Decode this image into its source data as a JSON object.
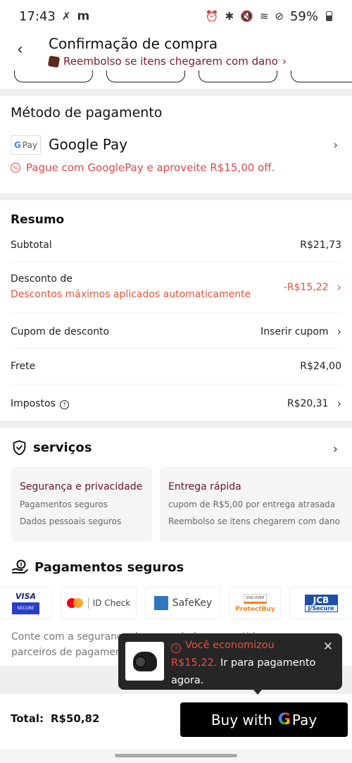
{
  "status_bar": {
    "time": "17:43",
    "left_icons": [
      "missed-call-icon",
      "m-app-icon"
    ],
    "right_icons": [
      "alarm-icon",
      "bluetooth-icon",
      "mute-icon",
      "wifi-icon",
      "do-not-disturb-icon"
    ],
    "battery": "59%"
  },
  "header": {
    "title": "Confirmação de compra",
    "refund_link": "Reembolso se itens chegarem com dano",
    "refund_chevron": "›"
  },
  "payment": {
    "heading": "Método de pagamento",
    "badge": "Pay",
    "method_name": "Google Pay",
    "promo": "Pague com GooglePay e aproveite R$15,00 off."
  },
  "summary": {
    "heading": "Resumo",
    "rows": [
      {
        "label": "Subtotal",
        "value": "R$21,73"
      },
      {
        "label": "Desconto de",
        "sublabel": "Descontos máximos aplicados automaticamente",
        "value": "-R$15,22"
      },
      {
        "label": "Cupom de desconto",
        "value": "Inserir cupom"
      },
      {
        "label": "Frete",
        "value": "R$24,00"
      },
      {
        "label": "Impostos",
        "value": "R$20,31"
      }
    ]
  },
  "services": {
    "heading": "serviços",
    "cards": [
      {
        "title": "Segurança e privacidade",
        "lines": [
          "Pagamentos seguros",
          "Dados pessoais seguros"
        ]
      },
      {
        "title": "Entrega rápida",
        "lines": [
          "cupom de R$5,00 por entrega atrasada",
          "Reembolso se itens chegarem com dano"
        ]
      }
    ]
  },
  "secure_payments": {
    "heading": "Pagamentos seguros",
    "logos": [
      {
        "top": "VISA",
        "bottom": "SECURE"
      },
      {
        "label": "ID Check"
      },
      {
        "label": "SafeKey"
      },
      {
        "top": "DISCOVER",
        "bottom": "ProtectBuy"
      },
      {
        "top": "JCB",
        "bottom": "J/Secure"
      }
    ],
    "note": "Conte com a segurança dos seus dados, garantida por nossos parceiros de pagamento."
  },
  "toast": {
    "saved_label": "Você economizou",
    "saved_amount": "R$15,22.",
    "cta": "Ir para pagamento agora.",
    "close": "✕"
  },
  "footer": {
    "total_label": "Total:",
    "total_value": "R$50,82",
    "buy_prefix": "Buy with",
    "buy_g": "G",
    "buy_suffix": "Pay"
  },
  "colors": {
    "accent_maroon": "#7a1a2a",
    "promo_red": "#e0474c",
    "discount_orange": "#e0563c",
    "toast_bg": "#262626"
  }
}
